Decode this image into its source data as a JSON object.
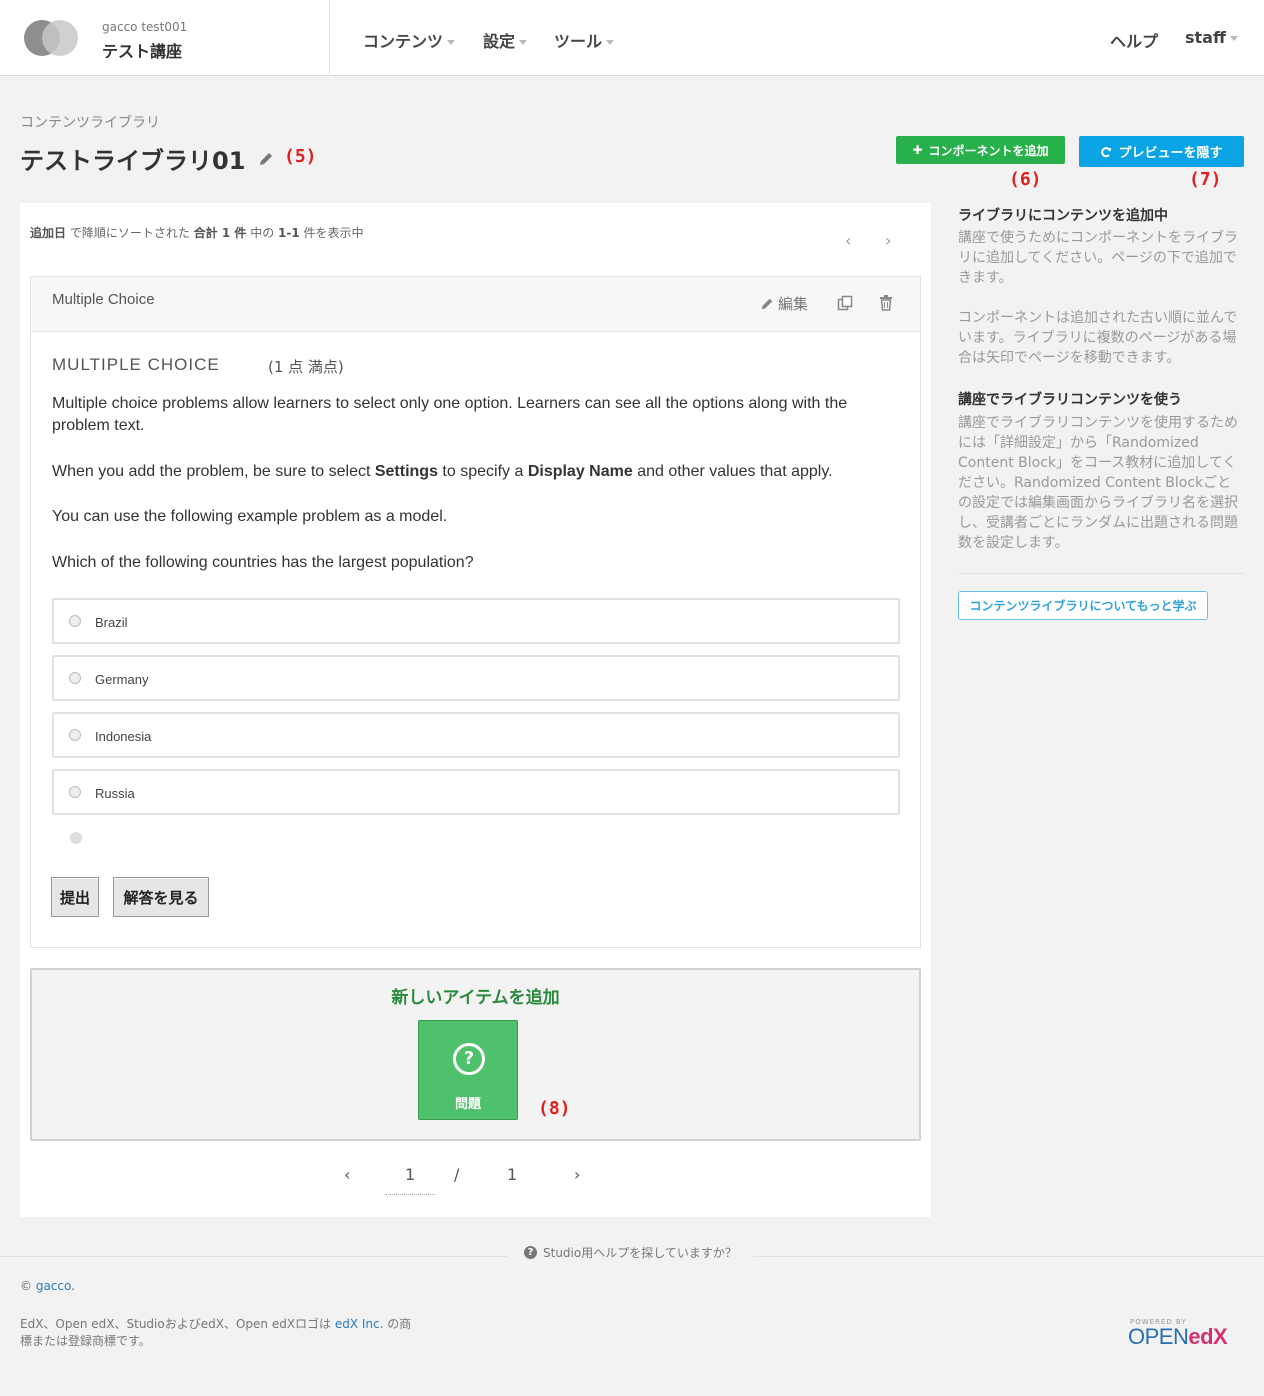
{
  "header": {
    "course_org": "gacco  test001",
    "course_title": "テスト講座",
    "nav": [
      "コンテンツ",
      "設定",
      "ツール"
    ],
    "help": "ヘルプ",
    "user": "staff"
  },
  "library": {
    "breadcrumb": "コンテンツライブラリ",
    "title": "テストライブラリ01",
    "add_component_label": "コンポーネントを追加",
    "hide_preview_label": "プレビューを隠す"
  },
  "annotations": {
    "a5": "(5)",
    "a6": "(6)",
    "a7": "(7)",
    "a8": "(8)"
  },
  "sort_info": {
    "field": "追加日",
    "text1": " で降順にソートされた ",
    "total": "合計 1 件",
    "text2": " 中の ",
    "range": "1-1",
    "text3": " 件を表示中"
  },
  "xblock": {
    "name": "Multiple Choice",
    "edit_label": "編集",
    "problem_header": "MULTIPLE CHOICE",
    "points": "(1 点 満点)",
    "p1": "Multiple choice problems allow learners to select only one option. Learners can see all the options along with the problem text.",
    "p2_a": "When you add the problem, be sure to select ",
    "p2_b": "Settings",
    "p2_c": " to specify a ",
    "p2_d": "Display Name",
    "p2_e": " and other values that apply.",
    "p3": "You can use the following example problem as a model.",
    "question": "Which of the following countries has the largest population?",
    "choices": [
      "Brazil",
      "Germany",
      "Indonesia",
      "Russia"
    ],
    "submit_label": "提出",
    "show_answer_label": "解答を見る"
  },
  "add_new": {
    "title": "新しいアイテムを追加",
    "problem_label": "問題"
  },
  "pagination": {
    "current": "1",
    "sep": "/",
    "total": "1"
  },
  "sidebar": {
    "h1": "ライブラリにコンテンツを追加中",
    "p1": "講座で使うためにコンポーネントをライブラリに追加してください。ページの下で追加できます。",
    "p2": "コンポーネントは追加された古い順に並んでいます。ライブラリに複数のページがある場合は矢印でページを移動できます。",
    "h2": "講座でライブラリコンテンツを使う",
    "p3": "講座でライブラリコンテンツを使用するためには「詳細設定」から「Randomized Content Block」をコース教材に追加してください。Randomized Content Blockごとの設定では編集画面からライブラリ名を選択し、受講者ごとにランダムに出題される問題数を設定します。",
    "learn_more": "コンテンツライブラリについてもっと学ぶ"
  },
  "footer": {
    "help": "Studio用ヘルプを探していますか？",
    "copy_sym": "© ",
    "copy_link": "gacco",
    "copy_dot": ".",
    "tm_a": "EdX、Open edX、StudioおよびedX、Open edXロゴは ",
    "tm_link": "edX Inc.",
    "tm_b": " の商標または登録商標です。",
    "logo_small": "POWERED BY",
    "logo_a": "OPEN",
    "logo_b": "edX"
  },
  "colors": {
    "green": "#28b04a",
    "blue": "#0aa3e4",
    "annotation": "#e02020"
  }
}
